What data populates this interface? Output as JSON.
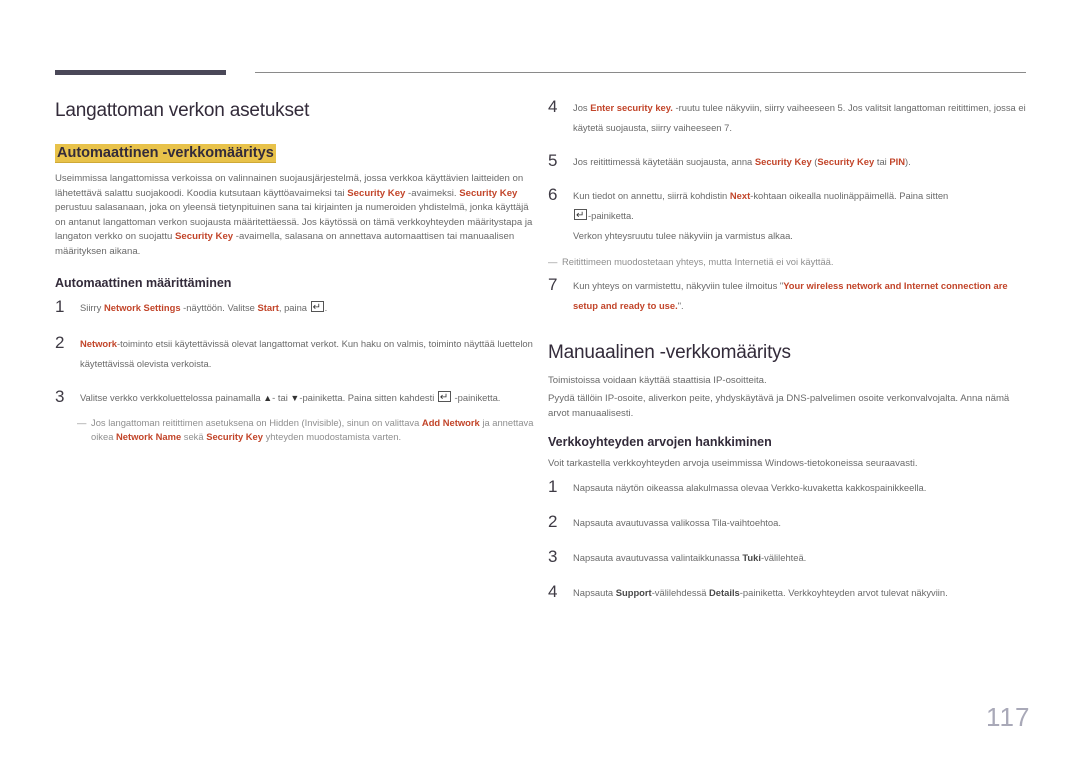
{
  "left": {
    "title": "Langattoman verkon asetukset",
    "subtitle": "Automaattinen -verkkomääritys",
    "intro": {
      "t1": "Useimmissa langattomissa verkoissa on valinnainen suojausjärjestelmä, jossa verkkoa käyttävien laitteiden on lähetettävä salattu suojakoodi. Koodia kutsutaan käyttöavaimeksi tai ",
      "k1": "Security Key",
      "t2": " -avaimeksi. ",
      "k2": "Security Key",
      "t3": " perustuu salasanaan, joka on yleensä tietynpituinen sana tai kirjainten ja numeroiden yhdistelmä, jonka käyttäjä on antanut langattoman verkon suojausta määritettäessä. Jos käytössä on tämä verkkoyhteyden määritystapa ja langaton verkko on suojattu ",
      "k3": "Security Key",
      "t4": " -avaimella, salasana on annettava automaattisen tai manuaalisen määrityksen aikana."
    },
    "section_title": "Automaattinen määrittäminen",
    "steps": [
      {
        "num": "1",
        "a": "Siirry ",
        "k1": "Network Settings",
        "b": " -näyttöön. Valitse ",
        "k2": "Start",
        "c": ", paina ",
        "d": "."
      },
      {
        "num": "2",
        "k1": "Network",
        "a": "-toiminto etsii käytettävissä olevat langattomat verkot. Kun haku on valmis, toiminto näyttää luettelon käytettävissä olevista verkoista."
      },
      {
        "num": "3",
        "a": "Valitse verkko verkkoluettelossa painamalla ",
        "up": "▲",
        "b": "- tai ",
        "down": "▼",
        "c": "-painiketta. Paina sitten kahdesti ",
        "d": " -painiketta."
      }
    ],
    "note": {
      "dash": "―",
      "a": "Jos langattoman reitittimen asetuksena on Hidden (Invisible), sinun on valittava ",
      "k1": "Add Network",
      "b": " ja annettava oikea ",
      "k2": "Network Name",
      "c": " sekä ",
      "k3": "Security Key",
      "d": " yhteyden muodostamista varten."
    }
  },
  "right": {
    "steps": [
      {
        "num": "4",
        "a": "Jos ",
        "k1": "Enter security key.",
        "b": " -ruutu tulee näkyviin, siirry vaiheeseen 5. Jos valitsit langattoman reitittimen, jossa ei käytetä suojausta, siirry vaiheeseen 7."
      },
      {
        "num": "5",
        "a": "Jos reitittimessä käytetään suojausta, anna ",
        "k1": "Security Key",
        "b": " (",
        "k2": "Security Key",
        "c": " tai ",
        "k3": "PIN",
        "d": ")."
      },
      {
        "num": "6",
        "a": "Kun tiedot on annettu, siirrä kohdistin ",
        "k1": "Next",
        "b": "-kohtaan oikealla nuolinäppäimellä. Paina sitten ",
        "c": "-painiketta.",
        "d": "Verkon yhteysruutu tulee näkyviin ja varmistus alkaa."
      },
      {
        "num": "7",
        "a": "Kun yhteys on varmistettu, näkyviin tulee ilmoitus \"",
        "k1": "Your wireless network and Internet connection are setup and ready to use.",
        "b": "\"."
      }
    ],
    "note": {
      "dash": "―",
      "text": "Reitittimeen muodostetaan yhteys, mutta Internetiä ei voi käyttää."
    },
    "manual_title": "Manuaalinen -verkkomääritys",
    "manual_p1": "Toimistoissa voidaan käyttää staattisia IP-osoitteita.",
    "manual_p2": "Pyydä tällöin IP-osoite, aliverkon peite, yhdyskäytävä ja DNS-palvelimen osoite verkonvalvojalta. Anna nämä arvot manuaalisesti.",
    "values_title": "Verkkoyhteyden arvojen hankkiminen",
    "values_intro": "Voit tarkastella verkkoyhteyden arvoja useimmissa Windows-tietokoneissa seuraavasti.",
    "values_steps": [
      {
        "num": "1",
        "a": "Napsauta näytön oikeassa alakulmassa olevaa Verkko-kuvaketta kakkospainikkeella."
      },
      {
        "num": "2",
        "a": "Napsauta avautuvassa valikossa Tila-vaihtoehtoa."
      },
      {
        "num": "3",
        "a": "Napsauta avautuvassa valintaikkunassa ",
        "k1": "Tuki",
        "b": "-välilehteä."
      },
      {
        "num": "4",
        "a": "Napsauta ",
        "k1": "Support",
        "b": "-välilehdessä ",
        "k2": "Details",
        "c": "-painiketta. Verkkoyhteyden arvot tulevat näkyviin."
      }
    ]
  },
  "page_number": "117"
}
